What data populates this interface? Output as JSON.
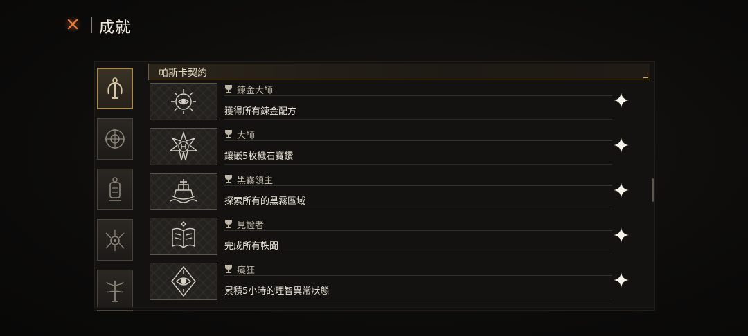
{
  "header": {
    "title": "成就",
    "close_icon": "close-x-icon",
    "accent_color": "#d8642a"
  },
  "categories": [
    {
      "icon": "tentacle-crest-icon",
      "active": true
    },
    {
      "icon": "compass-wheel-icon",
      "active": false
    },
    {
      "icon": "lantern-totem-icon",
      "active": false
    },
    {
      "icon": "spider-eye-icon",
      "active": false
    },
    {
      "icon": "tree-sigil-icon",
      "active": false
    }
  ],
  "group": {
    "title": "帕斯卡契約"
  },
  "achievements": [
    {
      "name": "鍊金大師",
      "description": "獲得所有鍊金配方",
      "icon": "alchemy-sun-eye-icon"
    },
    {
      "name": "大師",
      "description": "鑲嵌5枚穢石寶鑽",
      "icon": "gem-star-icon"
    },
    {
      "name": "黑霧領主",
      "description": "探索所有的黑霧區域",
      "icon": "ship-anchor-icon"
    },
    {
      "name": "見證者",
      "description": "完成所有軼聞",
      "icon": "open-book-icon"
    },
    {
      "name": "癡狂",
      "description": "累積5小時的理智異常狀態",
      "icon": "eye-diamond-icon"
    }
  ],
  "colors": {
    "gold": "#a68a55",
    "text_primary": "#ece6da",
    "text_secondary": "#bdb5a8"
  }
}
